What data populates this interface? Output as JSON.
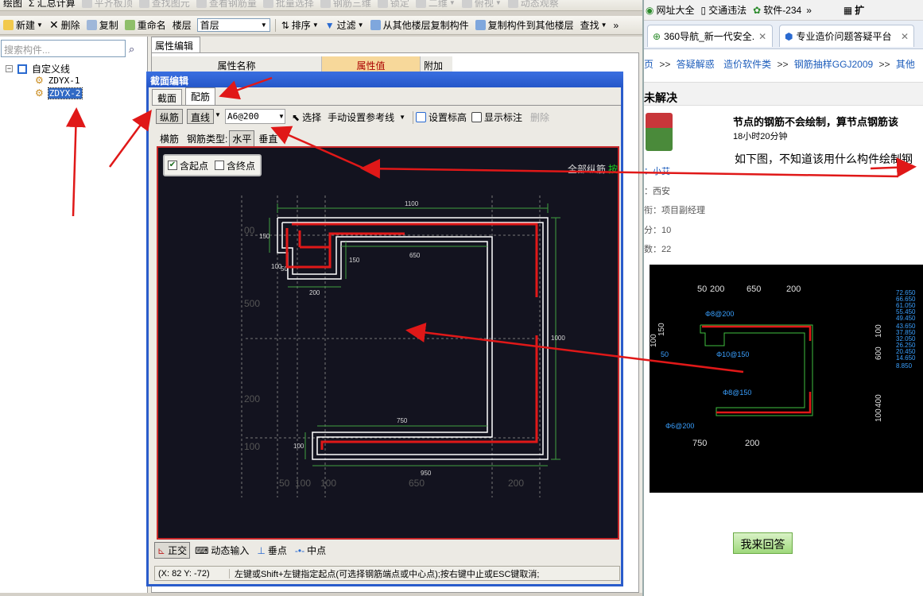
{
  "toolbar1": {
    "items": [
      "绘图",
      "Σ 汇总计算",
      "平齐板顶",
      "查找图元",
      "查看钢筋量",
      "批量选择",
      "钢筋三维",
      "锁定",
      "二维",
      "俯视",
      "动态观察"
    ]
  },
  "toolbar2": {
    "new": "新建",
    "delete": "删除",
    "copy": "复制",
    "rename": "重命名",
    "floor_label": "楼层",
    "floor_value": "首层",
    "sort": "排序",
    "filter": "过滤",
    "copy_from": "从其他楼层复制构件",
    "copy_to": "复制构件到其他楼层",
    "find": "查找"
  },
  "left": {
    "search_placeholder": "搜索构件...",
    "root": "自定义线",
    "items": [
      "ZDYX-1",
      "ZDYX-2"
    ]
  },
  "prop": {
    "tab": "属性编辑",
    "col_name": "属性名称",
    "col_value": "属性值",
    "col_extra": "附加"
  },
  "dialog": {
    "title": "截面编辑",
    "tab1": "截面",
    "tab2": "配筋",
    "btn_long": "纵筋",
    "btn_line": "直线",
    "rebar_value": "A6@200",
    "select": "选择",
    "manual_ref": "手动设置参考线",
    "set_elev": "设置标高",
    "show_label": "显示标注",
    "delete": "删除",
    "transverse": "横筋",
    "rebar_type_label": "钢筋类型:",
    "horizontal": "水平",
    "vertical": "垂直",
    "all_long": "全部纵筋"
  },
  "canvas": {
    "include_start": "含起点",
    "include_end": "含终点",
    "dims": {
      "d1100": "1100",
      "d150a": "150",
      "d650": "650",
      "d150b": "150",
      "d100": "100",
      "d50": "50",
      "d200": "200",
      "d1000": "1000",
      "d750": "750",
      "d100b": "100",
      "d950": "950",
      "g500": "500",
      "g200": "200",
      "g100": "100",
      "b50": "50",
      "b100a": "100",
      "b100b": "100",
      "b650": "650",
      "b200": "200",
      "d00": "00"
    }
  },
  "bottom": {
    "ortho": "正交",
    "dyn_input": "动态输入",
    "perp": "垂点",
    "mid": "中点"
  },
  "status": {
    "coords": "(X: 82 Y: -72)",
    "hint": "左键或Shift+左键指定起点(可选择钢筋端点或中心点);按右键中止或ESC键取消;"
  },
  "browser": {
    "fav": "网址大全",
    "traffic": "交通违法",
    "software": "软件-234",
    "ext": "扩",
    "tab1": "360导航_新一代安全...",
    "tab2": "专业造价问题答疑平台",
    "crumbs": [
      "页",
      ">>",
      "答疑解惑",
      "造价软件类",
      ">>",
      "钢筋抽样GGJ2009",
      ">>",
      "其他"
    ],
    "status": "未解决",
    "q_title": "节点的钢筋不会绘制，算节点钢筋该",
    "q_time": "18小时20分钟",
    "q_body": "如下图，不知道该用什么构件绘制钢",
    "user": "：小艾",
    "region": "：西安",
    "job": "衔：项目副经理",
    "score": "分：10",
    "count": "数：22",
    "reply": "我来回答"
  },
  "ref_img": {
    "top": [
      "50",
      "200",
      "650",
      "200"
    ],
    "left": [
      "100",
      "150"
    ],
    "left2": "50",
    "labels": [
      "Φ8@200",
      "Φ10@150",
      "Φ8@150",
      "Φ6@200"
    ],
    "right": [
      "100",
      "600",
      "400",
      "100"
    ],
    "bottom": [
      "750",
      "200"
    ],
    "elev": [
      "72.650",
      "66.650",
      "61.050",
      "55.450",
      "49.450",
      "43.650",
      "37.850",
      "32.050",
      "26.250",
      "20.450",
      "14.650",
      "8.850"
    ]
  }
}
